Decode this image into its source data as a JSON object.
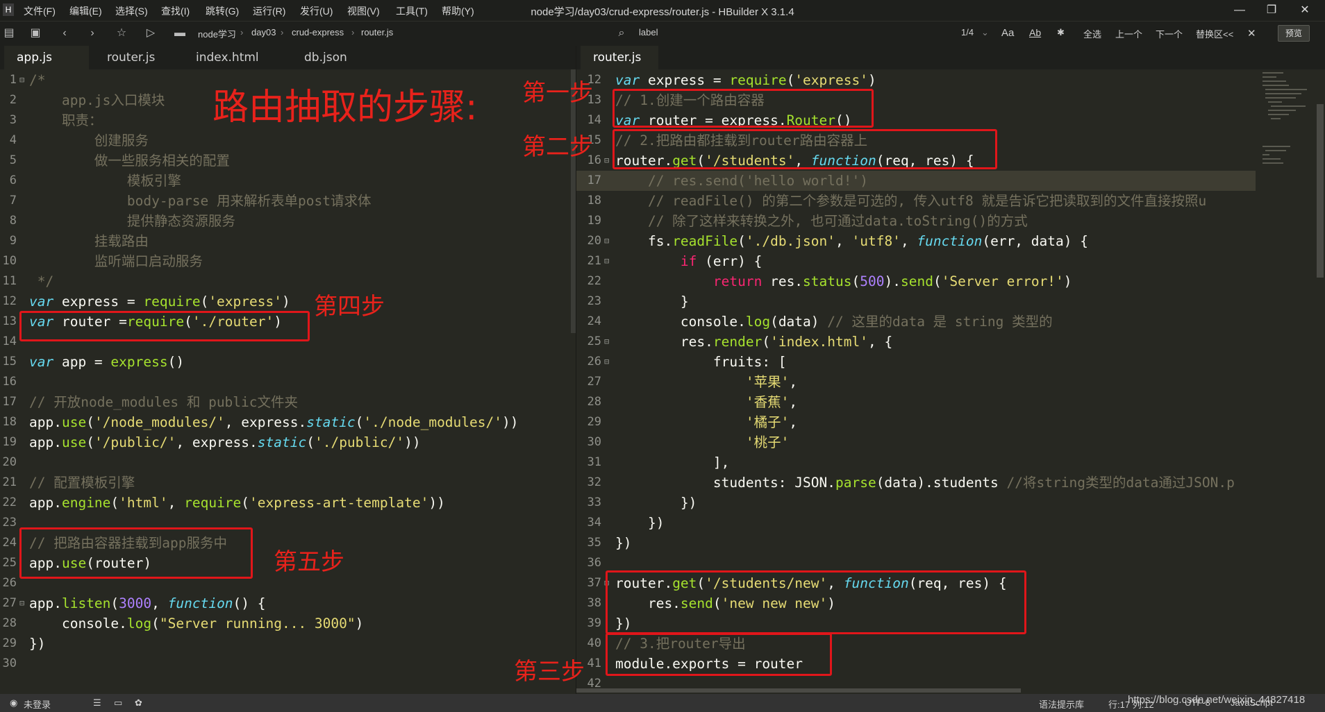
{
  "window": {
    "title": "node学习/day03/crud-express/router.js - HBuilder X 3.1.4",
    "app_icon": "H"
  },
  "menu": [
    "文件(F)",
    "编辑(E)",
    "选择(S)",
    "查找(I)",
    "跳转(G)",
    "运行(R)",
    "发行(U)",
    "视图(V)",
    "工具(T)",
    "帮助(Y)"
  ],
  "toolbar": {
    "breadcrumb": [
      "node学习",
      "day03",
      "crud-express",
      "router.js"
    ],
    "search_value": "label",
    "match_count": "1/4",
    "btn_aa": "Aa",
    "btn_ab": "Ab",
    "btn_select_all": "全选",
    "btn_prev": "上一个",
    "btn_next": "下一个",
    "btn_replace": "替换区<<",
    "btn_preview": "预览"
  },
  "left_tabs": [
    "app.js",
    "router.js",
    "index.html",
    "db.json"
  ],
  "right_tabs": [
    "router.js"
  ],
  "left_code": [
    {
      "n": "1",
      "f": "⊟",
      "t": [
        [
          "cm",
          "/*"
        ]
      ]
    },
    {
      "n": "2",
      "t": [
        [
          "cm",
          "    app.js入口模块"
        ]
      ]
    },
    {
      "n": "3",
      "t": [
        [
          "cm",
          "    职责："
        ]
      ]
    },
    {
      "n": "4",
      "t": [
        [
          "cm",
          "        创建服务"
        ]
      ]
    },
    {
      "n": "5",
      "t": [
        [
          "cm",
          "        做一些服务相关的配置"
        ]
      ]
    },
    {
      "n": "6",
      "t": [
        [
          "cm",
          "            模板引擎"
        ]
      ]
    },
    {
      "n": "7",
      "t": [
        [
          "cm",
          "            body-parse 用来解析表单post请求体"
        ]
      ]
    },
    {
      "n": "8",
      "t": [
        [
          "cm",
          "            提供静态资源服务"
        ]
      ]
    },
    {
      "n": "9",
      "t": [
        [
          "cm",
          "        挂载路由"
        ]
      ]
    },
    {
      "n": "10",
      "t": [
        [
          "cm",
          "        监听端口启动服务"
        ]
      ]
    },
    {
      "n": "11",
      "t": [
        [
          "cm",
          " */"
        ]
      ]
    },
    {
      "n": "12",
      "t": [
        [
          "kw",
          "var"
        ],
        [
          "pl",
          " express = "
        ],
        [
          "fn",
          "require"
        ],
        [
          "pl",
          "("
        ],
        [
          "st",
          "'express'"
        ],
        [
          "pl",
          ")"
        ]
      ]
    },
    {
      "n": "13",
      "t": [
        [
          "kw",
          "var"
        ],
        [
          "pl",
          " router ="
        ],
        [
          "fn",
          "require"
        ],
        [
          "pl",
          "("
        ],
        [
          "st",
          "'./router'"
        ],
        [
          "pl",
          ")"
        ]
      ]
    },
    {
      "n": "14",
      "t": []
    },
    {
      "n": "15",
      "t": [
        [
          "kw",
          "var"
        ],
        [
          "pl",
          " app = "
        ],
        [
          "fn",
          "express"
        ],
        [
          "pl",
          "()"
        ]
      ]
    },
    {
      "n": "16",
      "t": []
    },
    {
      "n": "17",
      "t": [
        [
          "cm",
          "// 开放node_modules 和 public文件夹"
        ]
      ]
    },
    {
      "n": "18",
      "t": [
        [
          "pl",
          "app."
        ],
        [
          "fn",
          "use"
        ],
        [
          "pl",
          "("
        ],
        [
          "st",
          "'/node_modules/'"
        ],
        [
          "pl",
          ", express."
        ],
        [
          "kw",
          "static"
        ],
        [
          "pl",
          "("
        ],
        [
          "st",
          "'./node_modules/'"
        ],
        [
          "pl",
          "))"
        ]
      ]
    },
    {
      "n": "19",
      "t": [
        [
          "pl",
          "app."
        ],
        [
          "fn",
          "use"
        ],
        [
          "pl",
          "("
        ],
        [
          "st",
          "'/public/'"
        ],
        [
          "pl",
          ", express."
        ],
        [
          "kw",
          "static"
        ],
        [
          "pl",
          "("
        ],
        [
          "st",
          "'./public/'"
        ],
        [
          "pl",
          "))"
        ]
      ]
    },
    {
      "n": "20",
      "t": []
    },
    {
      "n": "21",
      "t": [
        [
          "cm",
          "// 配置模板引擎"
        ]
      ]
    },
    {
      "n": "22",
      "t": [
        [
          "pl",
          "app."
        ],
        [
          "fn",
          "engine"
        ],
        [
          "pl",
          "("
        ],
        [
          "st",
          "'html'"
        ],
        [
          "pl",
          ", "
        ],
        [
          "fn",
          "require"
        ],
        [
          "pl",
          "("
        ],
        [
          "st",
          "'express-art-template'"
        ],
        [
          "pl",
          "))"
        ]
      ]
    },
    {
      "n": "23",
      "t": []
    },
    {
      "n": "24",
      "t": [
        [
          "cm",
          "// 把路由容器挂载到app服务中"
        ]
      ]
    },
    {
      "n": "25",
      "t": [
        [
          "pl",
          "app."
        ],
        [
          "fn",
          "use"
        ],
        [
          "pl",
          "(router)"
        ]
      ]
    },
    {
      "n": "26",
      "t": []
    },
    {
      "n": "27",
      "f": "⊟",
      "t": [
        [
          "pl",
          "app."
        ],
        [
          "fn",
          "listen"
        ],
        [
          "pl",
          "("
        ],
        [
          "nu",
          "3000"
        ],
        [
          "pl",
          ", "
        ],
        [
          "kw",
          "function"
        ],
        [
          "pl",
          "() {"
        ]
      ]
    },
    {
      "n": "28",
      "t": [
        [
          "pl",
          "    console."
        ],
        [
          "fn",
          "log"
        ],
        [
          "pl",
          "("
        ],
        [
          "st",
          "\"Server running... 3000\""
        ],
        [
          "pl",
          ")"
        ]
      ]
    },
    {
      "n": "29",
      "t": [
        [
          "pl",
          "})"
        ]
      ]
    },
    {
      "n": "30",
      "t": []
    }
  ],
  "right_code": [
    {
      "n": "12",
      "t": [
        [
          "kw",
          "var"
        ],
        [
          "pl",
          " express = "
        ],
        [
          "fn",
          "require"
        ],
        [
          "pl",
          "("
        ],
        [
          "st",
          "'express'"
        ],
        [
          "pl",
          ")"
        ]
      ]
    },
    {
      "n": "13",
      "t": [
        [
          "cm",
          "// 1.创建一个路由容器"
        ]
      ]
    },
    {
      "n": "14",
      "t": [
        [
          "kw",
          "var"
        ],
        [
          "pl",
          " router = express."
        ],
        [
          "fn",
          "Router"
        ],
        [
          "pl",
          "()"
        ]
      ]
    },
    {
      "n": "15",
      "t": [
        [
          "cm",
          "// 2.把路由都挂载到router路由容器上"
        ]
      ]
    },
    {
      "n": "16",
      "f": "⊟",
      "t": [
        [
          "pl",
          "router."
        ],
        [
          "fn",
          "get"
        ],
        [
          "pl",
          "("
        ],
        [
          "st",
          "'/students'"
        ],
        [
          "pl",
          ", "
        ],
        [
          "kw",
          "function"
        ],
        [
          "pl",
          "(req, res) {"
        ]
      ]
    },
    {
      "n": "17",
      "cur": true,
      "t": [
        [
          "cm",
          "    // res.send('hello world!')"
        ]
      ]
    },
    {
      "n": "18",
      "t": [
        [
          "cm",
          "    // readFile() 的第二个参数是可选的, 传入utf8 就是告诉它把读取到的文件直接按照u"
        ]
      ]
    },
    {
      "n": "19",
      "t": [
        [
          "cm",
          "    // 除了这样来转换之外, 也可通过data.toString()的方式"
        ]
      ]
    },
    {
      "n": "20",
      "f": "⊟",
      "t": [
        [
          "pl",
          "    fs."
        ],
        [
          "fn",
          "readFile"
        ],
        [
          "pl",
          "("
        ],
        [
          "st",
          "'./db.json'"
        ],
        [
          "pl",
          ", "
        ],
        [
          "st",
          "'utf8'"
        ],
        [
          "pl",
          ", "
        ],
        [
          "kw",
          "function"
        ],
        [
          "pl",
          "(err, data) {"
        ]
      ]
    },
    {
      "n": "21",
      "f": "⊟",
      "t": [
        [
          "pl",
          "        "
        ],
        [
          "rd",
          "if"
        ],
        [
          "pl",
          " (err) {"
        ]
      ]
    },
    {
      "n": "22",
      "t": [
        [
          "pl",
          "            "
        ],
        [
          "rd",
          "return"
        ],
        [
          "pl",
          " res."
        ],
        [
          "fn",
          "status"
        ],
        [
          "pl",
          "("
        ],
        [
          "nu",
          "500"
        ],
        [
          "pl",
          ")."
        ],
        [
          "fn",
          "send"
        ],
        [
          "pl",
          "("
        ],
        [
          "st",
          "'Server error!'"
        ],
        [
          "pl",
          ")"
        ]
      ]
    },
    {
      "n": "23",
      "t": [
        [
          "pl",
          "        }"
        ]
      ]
    },
    {
      "n": "24",
      "t": [
        [
          "pl",
          "        console."
        ],
        [
          "fn",
          "log"
        ],
        [
          "pl",
          "(data) "
        ],
        [
          "cm",
          "// 这里的data 是 string 类型的"
        ]
      ]
    },
    {
      "n": "25",
      "f": "⊟",
      "t": [
        [
          "pl",
          "        res."
        ],
        [
          "fn",
          "render"
        ],
        [
          "pl",
          "("
        ],
        [
          "st",
          "'index.html'"
        ],
        [
          "pl",
          ", {"
        ]
      ]
    },
    {
      "n": "26",
      "f": "⊟",
      "t": [
        [
          "pl",
          "            fruits: ["
        ]
      ]
    },
    {
      "n": "27",
      "t": [
        [
          "pl",
          "                "
        ],
        [
          "st",
          "'苹果'"
        ],
        [
          "pl",
          ","
        ]
      ]
    },
    {
      "n": "28",
      "t": [
        [
          "pl",
          "                "
        ],
        [
          "st",
          "'香蕉'"
        ],
        [
          "pl",
          ","
        ]
      ]
    },
    {
      "n": "29",
      "t": [
        [
          "pl",
          "                "
        ],
        [
          "st",
          "'橘子'"
        ],
        [
          "pl",
          ","
        ]
      ]
    },
    {
      "n": "30",
      "t": [
        [
          "pl",
          "                "
        ],
        [
          "st",
          "'桃子'"
        ]
      ]
    },
    {
      "n": "31",
      "t": [
        [
          "pl",
          "            ],"
        ]
      ]
    },
    {
      "n": "32",
      "t": [
        [
          "pl",
          "            students: JSON."
        ],
        [
          "fn",
          "parse"
        ],
        [
          "pl",
          "(data).students "
        ],
        [
          "cm",
          "//将string类型的data通过JSON.p"
        ]
      ]
    },
    {
      "n": "33",
      "t": [
        [
          "pl",
          "        })"
        ]
      ]
    },
    {
      "n": "34",
      "t": [
        [
          "pl",
          "    })"
        ]
      ]
    },
    {
      "n": "35",
      "t": [
        [
          "pl",
          "})"
        ]
      ]
    },
    {
      "n": "36",
      "t": []
    },
    {
      "n": "37",
      "f": "⊟",
      "t": [
        [
          "pl",
          "router."
        ],
        [
          "fn",
          "get"
        ],
        [
          "pl",
          "("
        ],
        [
          "st",
          "'/students/new'"
        ],
        [
          "pl",
          ", "
        ],
        [
          "kw",
          "function"
        ],
        [
          "pl",
          "(req, res) {"
        ]
      ]
    },
    {
      "n": "38",
      "t": [
        [
          "pl",
          "    res."
        ],
        [
          "fn",
          "send"
        ],
        [
          "pl",
          "("
        ],
        [
          "st",
          "'new new new'"
        ],
        [
          "pl",
          ")"
        ]
      ]
    },
    {
      "n": "39",
      "t": [
        [
          "pl",
          "})"
        ]
      ]
    },
    {
      "n": "40",
      "t": [
        [
          "cm",
          "// 3.把router导出"
        ]
      ]
    },
    {
      "n": "41",
      "t": [
        [
          "pl",
          "module.exports = router"
        ]
      ]
    },
    {
      "n": "42",
      "t": []
    }
  ],
  "annotations": {
    "title": "路由抽取的步骤:",
    "step1": "第一步",
    "step2": "第二步",
    "step3": "第三步",
    "step4": "第四步",
    "step5": "第五步"
  },
  "status": {
    "login": "未登录",
    "hint": "语法提示库",
    "position": "行:17  列:12",
    "encoding": "UTF-8",
    "language": "JavaScript",
    "watermark": "https://blog.csdn.net/weixin_44827418"
  },
  "colors": {
    "bg": "#272822",
    "keyword": "#66d9ef",
    "string": "#e6db74",
    "function": "#a6e22e",
    "comment": "#75715e",
    "number": "#ae81ff",
    "control": "#f92672",
    "annotation": "#e0161a"
  }
}
